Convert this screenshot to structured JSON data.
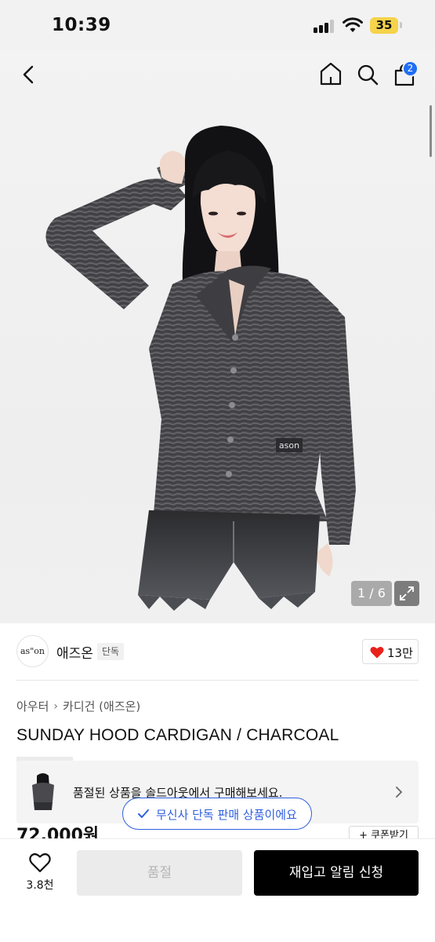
{
  "status_bar": {
    "time": "10:39",
    "battery_level": "35"
  },
  "nav": {
    "back_icon": "chevron-left-icon",
    "home_icon": "home-icon",
    "search_icon": "search-icon",
    "bag_icon": "shopping-bag-icon",
    "bag_badge_count": "2"
  },
  "gallery": {
    "counter": "1 / 6",
    "expand_icon": "expand-arrows-icon",
    "print_text": "ason"
  },
  "brand": {
    "logo_text": "as\"on",
    "name": "애즈온",
    "tag": "단독",
    "like_icon": "heart-icon",
    "like_count": "13만"
  },
  "product": {
    "breadcrumb": [
      "아우터",
      "카디건 (애즈온)"
    ],
    "title": "SUNDAY HOOD CARDIGAN / CHARCOAL",
    "soldout_message": "품절된 상품을 솔드아웃에서 구매해보세요.",
    "exclusive_label": "무신사 단독 판매 상품이에요",
    "price": "72,000원",
    "coupon_label": "+ 쿠폰받기"
  },
  "bottom_bar": {
    "wish_count": "3.8천",
    "soldout_button": "품절",
    "restock_button": "재입고 알림 신청"
  },
  "colors": {
    "accent_blue": "#2f5fe0",
    "badge_blue": "#1f6ef5",
    "heart_red": "#e8221b",
    "battery_yellow": "#f5d34a",
    "primary_button": "#000000"
  }
}
